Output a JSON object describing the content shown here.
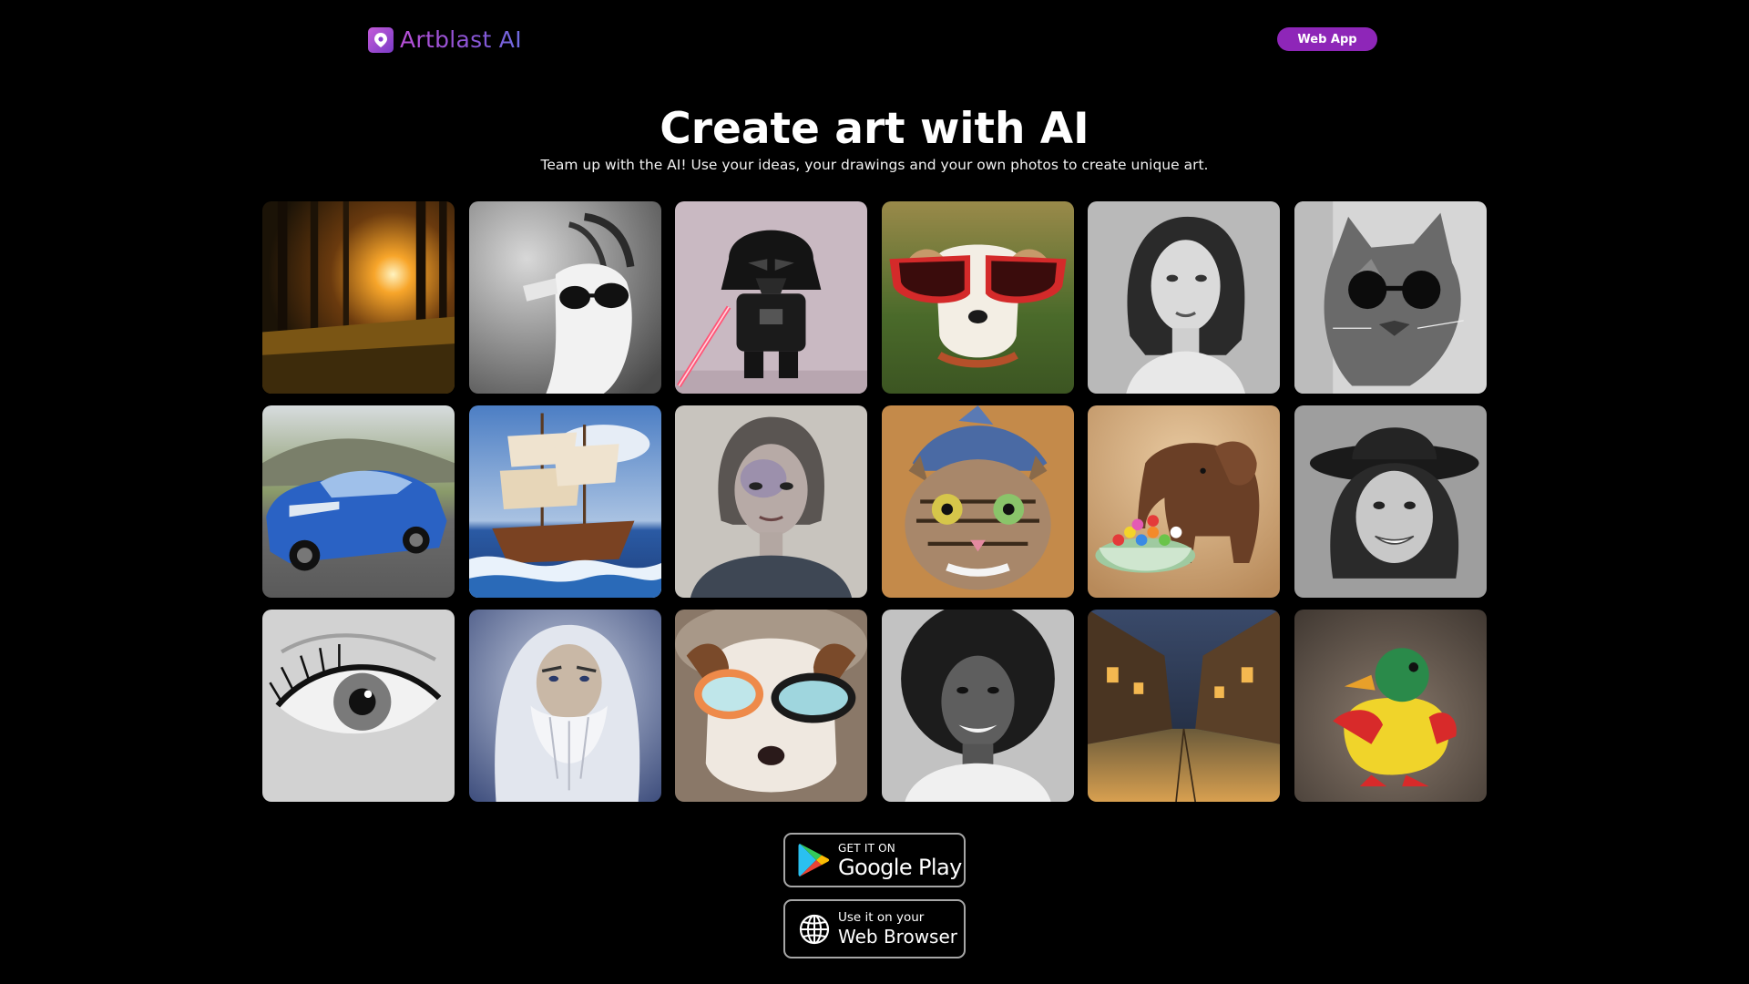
{
  "header": {
    "logo_text": "Artblast AI",
    "logo_icon": "rocket-pin-icon",
    "web_app_label": "Web App"
  },
  "hero": {
    "title": "Create art with AI",
    "subtitle": "Team up with the AI! Use your ideas, your drawings and your own photos to create unique art."
  },
  "gallery": {
    "tiles": [
      {
        "subject": "sunset-forest"
      },
      {
        "subject": "goat-sunglasses"
      },
      {
        "subject": "darth-vader-figure"
      },
      {
        "subject": "dog-red-sunglasses"
      },
      {
        "subject": "woman-portrait-bw"
      },
      {
        "subject": "cat-sunglasses-bw"
      },
      {
        "subject": "blue-mustang"
      },
      {
        "subject": "sailing-ship"
      },
      {
        "subject": "painted-woman"
      },
      {
        "subject": "cat-blue-hat"
      },
      {
        "subject": "wooden-elephant-candy"
      },
      {
        "subject": "woman-hat-bw"
      },
      {
        "subject": "eye-closeup-bw"
      },
      {
        "subject": "old-wizard"
      },
      {
        "subject": "dog-goggles"
      },
      {
        "subject": "woman-afro-bw"
      },
      {
        "subject": "night-street"
      },
      {
        "subject": "toy-duck"
      }
    ]
  },
  "stores": {
    "google_play": {
      "small": "GET IT ON",
      "big": "Google Play",
      "icon": "google-play-icon"
    },
    "web_browser": {
      "small": "Use it on your",
      "big": "Web Browser",
      "icon": "globe-icon"
    }
  },
  "colors": {
    "background": "#000000",
    "accent": "#8e26b8",
    "logo_gradient_start": "#b94fd8",
    "logo_gradient_end": "#6e6be0"
  }
}
